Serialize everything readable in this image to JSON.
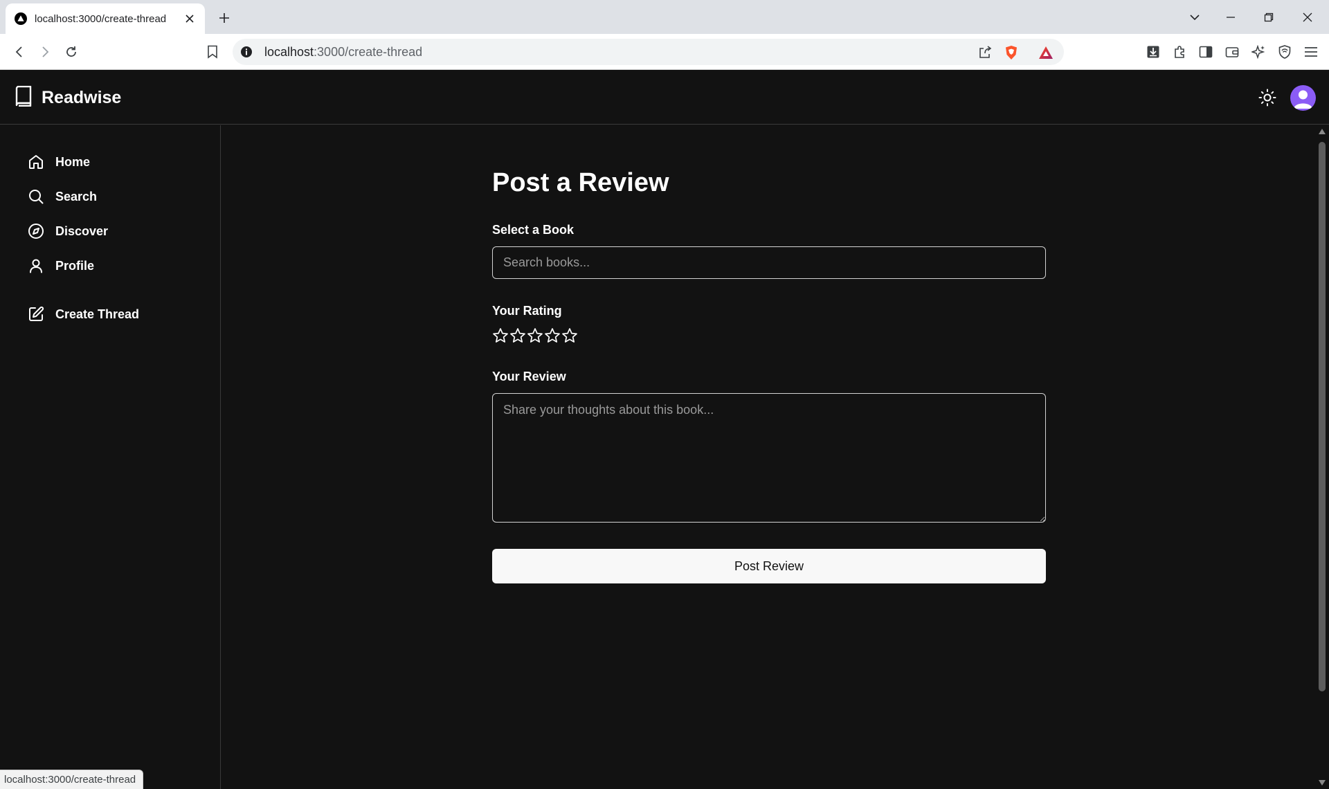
{
  "browser": {
    "tab_title": "localhost:3000/create-thread",
    "url_host": "localhost",
    "url_path": ":3000/create-thread",
    "status_url": "localhost:3000/create-thread"
  },
  "app": {
    "brand": "Readwise",
    "accent_color": "#8b5cf6"
  },
  "sidebar": {
    "items": [
      {
        "label": "Home",
        "icon": "home-icon"
      },
      {
        "label": "Search",
        "icon": "search-icon"
      },
      {
        "label": "Discover",
        "icon": "compass-icon"
      },
      {
        "label": "Profile",
        "icon": "user-icon"
      },
      {
        "label": "Create Thread",
        "icon": "edit-icon"
      }
    ]
  },
  "form": {
    "title": "Post a Review",
    "book_label": "Select a Book",
    "book_placeholder": "Search books...",
    "book_value": "",
    "rating_label": "Your Rating",
    "rating_value": 0,
    "rating_max": 5,
    "review_label": "Your Review",
    "review_placeholder": "Share your thoughts about this book...",
    "review_value": "",
    "submit_label": "Post Review"
  }
}
